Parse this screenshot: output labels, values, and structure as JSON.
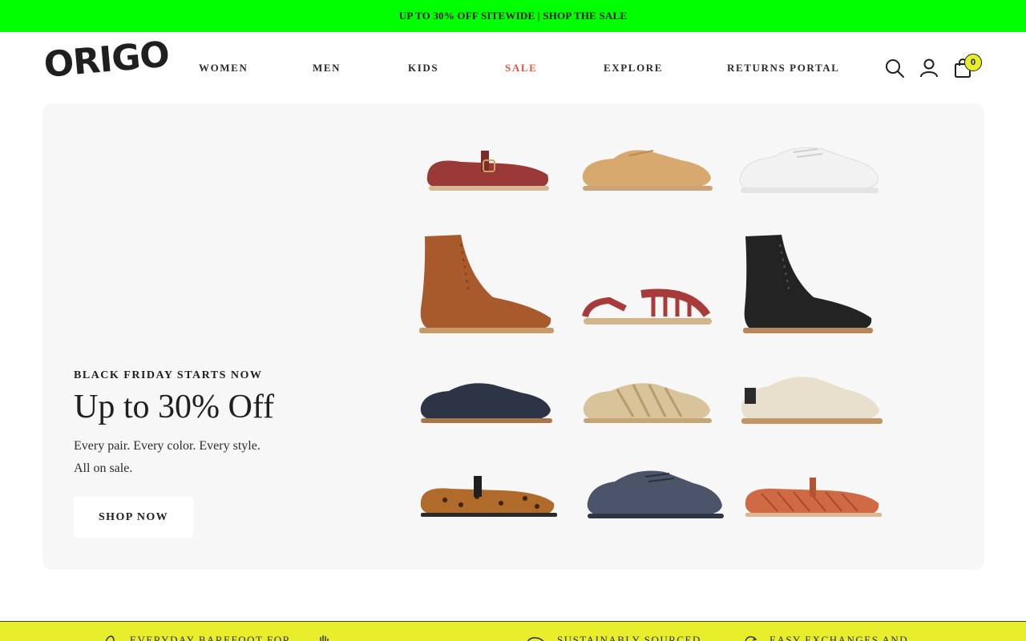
{
  "announcement": {
    "text": "UP TO 30% OFF SITEWIDE | SHOP THE SALE"
  },
  "brand": {
    "logo_text": "ORIGO"
  },
  "nav": {
    "items": [
      {
        "label": "WOMEN"
      },
      {
        "label": "MEN"
      },
      {
        "label": "KIDS"
      },
      {
        "label": "SALE"
      },
      {
        "label": "EXPLORE"
      },
      {
        "label": "RETURNS PORTAL"
      }
    ]
  },
  "header_icons": {
    "search": "search-icon",
    "account": "account-icon",
    "cart": "bag-icon",
    "cart_count": "0"
  },
  "hero": {
    "kicker": "BLACK FRIDAY STARTS NOW",
    "headline": "Up to 30% Off",
    "body_line_1": "Every pair. Every color. Every style.",
    "body_line_2": "All on sale.",
    "cta_label": "SHOP NOW"
  },
  "features": [
    {
      "label": "EVERYDAY BAREFOOT FOR"
    },
    {
      "label": "SUSTAINABLY SOURCED"
    },
    {
      "label": "EASY EXCHANGES AND"
    }
  ],
  "colors": {
    "announcement_bg": "#00ff00",
    "sale_accent": "#e8553b",
    "badge_yellow": "#e8ee2b",
    "hero_bg": "#f7f7f7"
  }
}
